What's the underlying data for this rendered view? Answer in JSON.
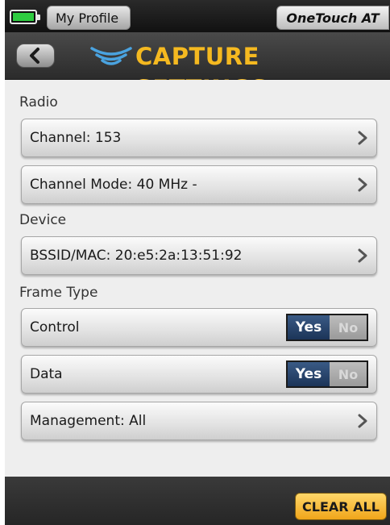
{
  "statusbar": {
    "battery_icon": "battery-icon",
    "profile_label": "My Profile",
    "brand_label": "OneTouch AT"
  },
  "titlebar": {
    "back_icon": "chevron-left-icon",
    "logo_icon": "wifi-waves-icon",
    "title": "CAPTURE SETTINGS"
  },
  "sections": {
    "radio": {
      "label": "Radio",
      "channel": "Channel: 153",
      "channel_mode": "Channel Mode: 40 MHz -"
    },
    "device": {
      "label": "Device",
      "bssid": "BSSID/MAC: 20:e5:2a:13:51:92"
    },
    "frame_type": {
      "label": "Frame Type",
      "control": {
        "label": "Control",
        "yes": "Yes",
        "no": "No",
        "selected": "Yes"
      },
      "data": {
        "label": "Data",
        "yes": "Yes",
        "no": "No",
        "selected": "Yes"
      },
      "management": "Management: All"
    }
  },
  "bottombar": {
    "clear_all_label": "CLEAR ALL"
  },
  "colors": {
    "title": "#f5b920",
    "toggle_on": "#1c3458",
    "clear_button": "#f0a51a",
    "battery": "#2ecc40"
  }
}
